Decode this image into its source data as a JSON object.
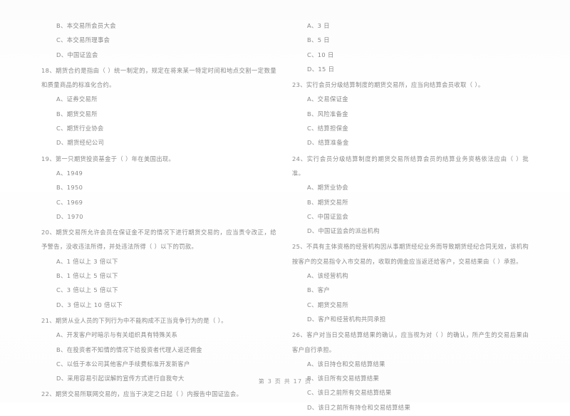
{
  "document": {
    "type": "exam-paper",
    "language": "zh-CN",
    "text_color": "#8a8a8a",
    "background_color": "#ffffff",
    "footer": "第 3 页 共 17 页"
  },
  "left_column": {
    "orphan_options": [
      "B、本交易所会员大会",
      "C、本交易所理事会",
      "D、中国证监会"
    ],
    "questions": [
      {
        "number": "18",
        "stem": "18、期货合约是指由（    ）统一制定的，规定在将来某一特定时间和地点交割一定数量和质量商品的标准化合约。",
        "options": [
          "A、证券交易所",
          "B、期货交易所",
          "C、期货行业协会",
          "D、期货经纪公司"
        ]
      },
      {
        "number": "19",
        "stem": "19、第一只期货投资基金于（    ）年在美国出现。",
        "options": [
          "A、1949",
          "B、1950",
          "C、1969",
          "D、1970"
        ]
      },
      {
        "number": "20",
        "stem": "20、期货交易所允许会员在保证金不足的情况下进行期货交易的，应当责令改正，给予警告，没收违法所得，并处违法所得（    ）以下的罚款。",
        "options": [
          "A、1 倍以上 3 倍以下",
          "B、1 倍以上 5 倍以下",
          "C、3 倍以上 5 倍以下",
          "D、3 倍以上 10 倍以下"
        ]
      },
      {
        "number": "21",
        "stem": "21、期货从业人员的下列行为中不能构成不正当竞争行为的是（    ）。",
        "options": [
          "A、开发客户时暗示与有关组织具有特殊关系",
          "B、在投资者不知情的情况下给投资者代理人返还佣金",
          "C、以低于本公司其他客户手续费标准开发新客户",
          "D、采用容易引起误解的宣传方式进行自我夸大"
        ]
      },
      {
        "number": "22",
        "stem": "22、期货交易所联网交易的，应当于决定之日起（    ）内报告中国证监会。",
        "options": []
      }
    ]
  },
  "right_column": {
    "orphan_options": [
      "A、3 日",
      "B、5 日",
      "C、10 日",
      "D、15 日"
    ],
    "questions": [
      {
        "number": "23",
        "stem": "23、实行会员分级结算制度的期货交易所，应当向结算会员收取（    ）。",
        "options": [
          "A、交易保证金",
          "B、风险准备金",
          "C、结算担保金",
          "D、结算准备金"
        ]
      },
      {
        "number": "24",
        "stem": "24、实行会员分级结算制度的期货交易所结算会员的结算业务资格依法应由（    ）批准。",
        "options": [
          "A、期货业协会",
          "B、期货交易所",
          "C、中国证监会",
          "D、中国证监会的派出机构"
        ]
      },
      {
        "number": "25",
        "stem": "25、不具有主体资格的经营机构因从事期货经纪业务而导致期货经纪合同无效，该机构按客户的交易指令入市交易的，收取的佣金应当返还给客户，交易结果由（    ）承担。",
        "options": [
          "A、该经营机构",
          "B、客户",
          "C、期货交易所",
          "D、客户和经营机构共同承担"
        ]
      },
      {
        "number": "26",
        "stem": "26、客户对当日交易结算结果的确认，应当视为对（    ）的确认，所产生的交易后果由客户自行承担。",
        "options": [
          "A、该日持仓和交易结算结果",
          "B、该日所有交易结算结果",
          "C、该日之前所有交易结算结果",
          "D、该日之前所有持仓和交易结算结果"
        ]
      }
    ]
  }
}
